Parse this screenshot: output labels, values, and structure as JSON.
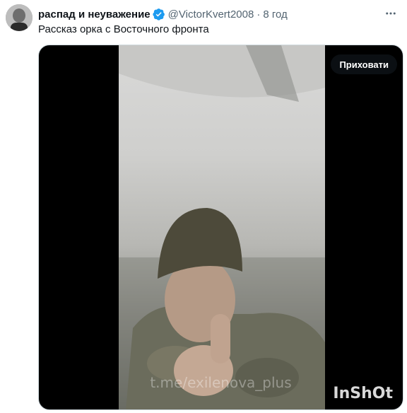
{
  "tweet": {
    "author_name": "распад и неуважение",
    "handle": "@VictorKvert2008",
    "separator": "·",
    "time": "8 год",
    "text": "Рассказ орка с Восточного фронта"
  },
  "media": {
    "hide_label": "Приховати",
    "watermark": "t.me/exilenova_plus",
    "logo": "InShOt"
  },
  "icons": {
    "verified": "verified-badge-icon",
    "more": "more-options-icon"
  },
  "colors": {
    "verified_blue": "#1d9bf0",
    "secondary_text": "#536471"
  }
}
